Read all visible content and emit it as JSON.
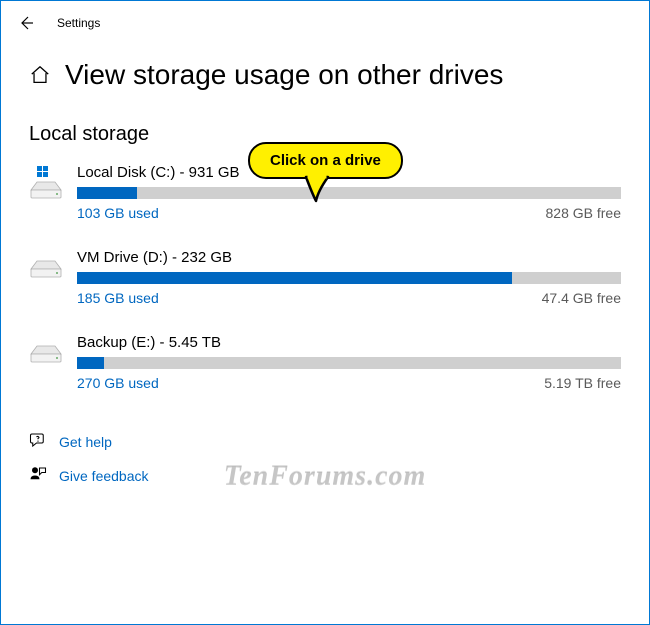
{
  "topbar": {
    "title": "Settings"
  },
  "header": {
    "title": "View storage usage on other drives"
  },
  "section": {
    "heading": "Local storage"
  },
  "callout": {
    "text": "Click on a drive"
  },
  "drives": [
    {
      "title": "Local Disk (C:) - 931 GB",
      "used": "103 GB used",
      "free": "828 GB free",
      "pct": 11,
      "os": true
    },
    {
      "title": "VM Drive (D:) - 232 GB",
      "used": "185 GB used",
      "free": "47.4 GB free",
      "pct": 80,
      "os": false
    },
    {
      "title": "Backup (E:) - 5.45 TB",
      "used": "270 GB used",
      "free": "5.19 TB free",
      "pct": 5,
      "os": false
    }
  ],
  "footer": {
    "help": "Get help",
    "feedback": "Give feedback"
  },
  "watermark": "TenForums.com",
  "chart_data": {
    "type": "bar",
    "title": "Local storage usage",
    "series": [
      {
        "name": "Local Disk (C:)",
        "total_gb": 931,
        "used_gb": 103,
        "free_gb": 828
      },
      {
        "name": "VM Drive (D:)",
        "total_gb": 232,
        "used_gb": 185,
        "free_gb": 47.4
      },
      {
        "name": "Backup (E:)",
        "total_tb": 5.45,
        "used_gb": 270,
        "free_tb": 5.19
      }
    ]
  }
}
